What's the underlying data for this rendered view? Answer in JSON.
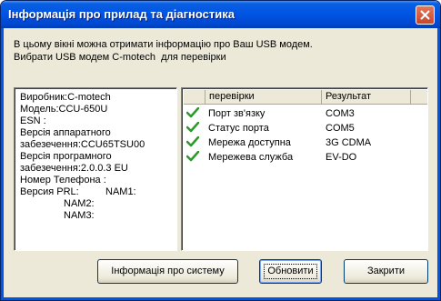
{
  "window": {
    "title": "Інформація про прилад та діагностика"
  },
  "description": {
    "line1": "В цьому вікні можна отримати інформацію про Ваш USB модем.",
    "line2": "Вибрати USB модем C-motech  для перевірки"
  },
  "device_info": [
    "Виробник:C-motech",
    "Модель:CCU-650U",
    "ESN :",
    "Версія аппаратного",
    "забезечення:CCU65TSU00",
    "Версія програмного",
    "забезечення:2.0.0.3 EU",
    "Номер Телефона :",
    "Версия PRL:",
    "NAM1:",
    "NAM2:",
    "NAM3:"
  ],
  "diagnostics": {
    "columns": [
      "",
      "перевірки",
      "Результат"
    ],
    "rows": [
      {
        "icon": "check-icon",
        "check": "Порт зв'язку",
        "result": "COM3"
      },
      {
        "icon": "check-icon",
        "check": "Статус порта",
        "result": "COM5"
      },
      {
        "icon": "check-icon",
        "check": "Мережа доступна",
        "result": "3G CDMA"
      },
      {
        "icon": "check-icon",
        "check": "Мережева служба",
        "result": "EV-DO"
      }
    ]
  },
  "buttons": {
    "system_info": "Інформація про систему",
    "refresh": "Обновити",
    "close": "Закрити"
  },
  "colors": {
    "titlebar": "#0055e5",
    "dialog_bg": "#ece9d8",
    "check": "#2a9a2a",
    "close_button": "#d9573b"
  }
}
